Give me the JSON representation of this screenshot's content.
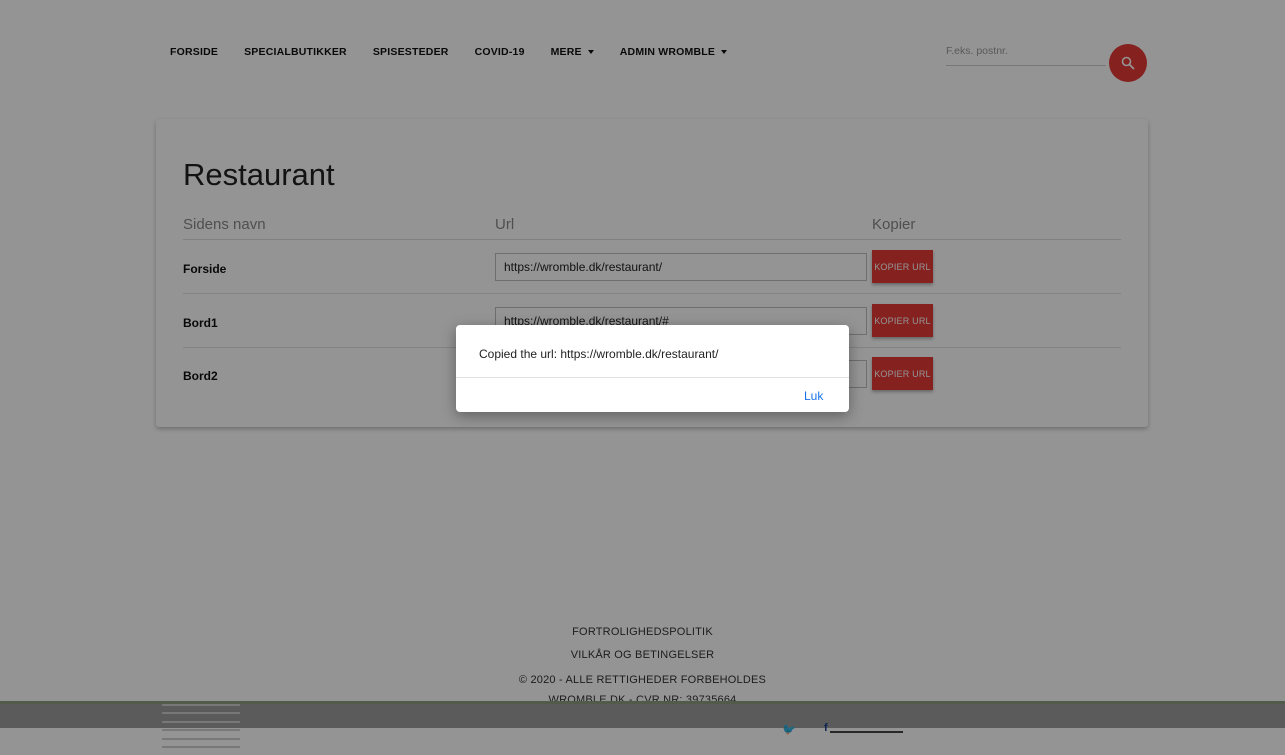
{
  "nav": {
    "items": [
      {
        "label": "FORSIDE",
        "dropdown": false
      },
      {
        "label": "SPECIALBUTIKKER",
        "dropdown": false
      },
      {
        "label": "SPISESTEDER",
        "dropdown": false
      },
      {
        "label": "COVID-19",
        "dropdown": false
      },
      {
        "label": "MERE",
        "dropdown": true
      },
      {
        "label": "ADMIN WROMBLE",
        "dropdown": true
      }
    ],
    "search_placeholder": "F.eks. postnr.",
    "search_icon": "magnifier-icon"
  },
  "card": {
    "title": "Restaurant",
    "columns": {
      "name": "Sidens navn",
      "url": "Url",
      "copy": "Kopier"
    },
    "rows": [
      {
        "name": "Forside",
        "url": "https://wromble.dk/restaurant/",
        "button": "KOPIER URL"
      },
      {
        "name": "Bord1",
        "url": "https://wromble.dk/restaurant/#",
        "button": "KOPIER URL"
      },
      {
        "name": "Bord2",
        "url": "",
        "button": "KOPIER URL"
      }
    ]
  },
  "footer": {
    "privacy": "FORTROLIGHEDSPOLITIK",
    "terms": "VILKÅR OG BETINGELSER",
    "copyright": "© 2020 - ALLE RETTIGHEDER FORBEHOLDES",
    "company": "WROMBLE.DK - CVR NR: 39735664",
    "twitter_icon": "twitter-icon",
    "facebook_icon": "facebook-icon",
    "twitter_glyph": "🐦",
    "facebook_glyph": "f"
  },
  "dialog": {
    "message": "Copied the url: https://wromble.dk/restaurant/",
    "close_label": "Luk"
  },
  "colors": {
    "accent_red": "#e53935",
    "link_blue": "#1a73e8",
    "overlay": "rgba(0,0,0,0.42)"
  }
}
